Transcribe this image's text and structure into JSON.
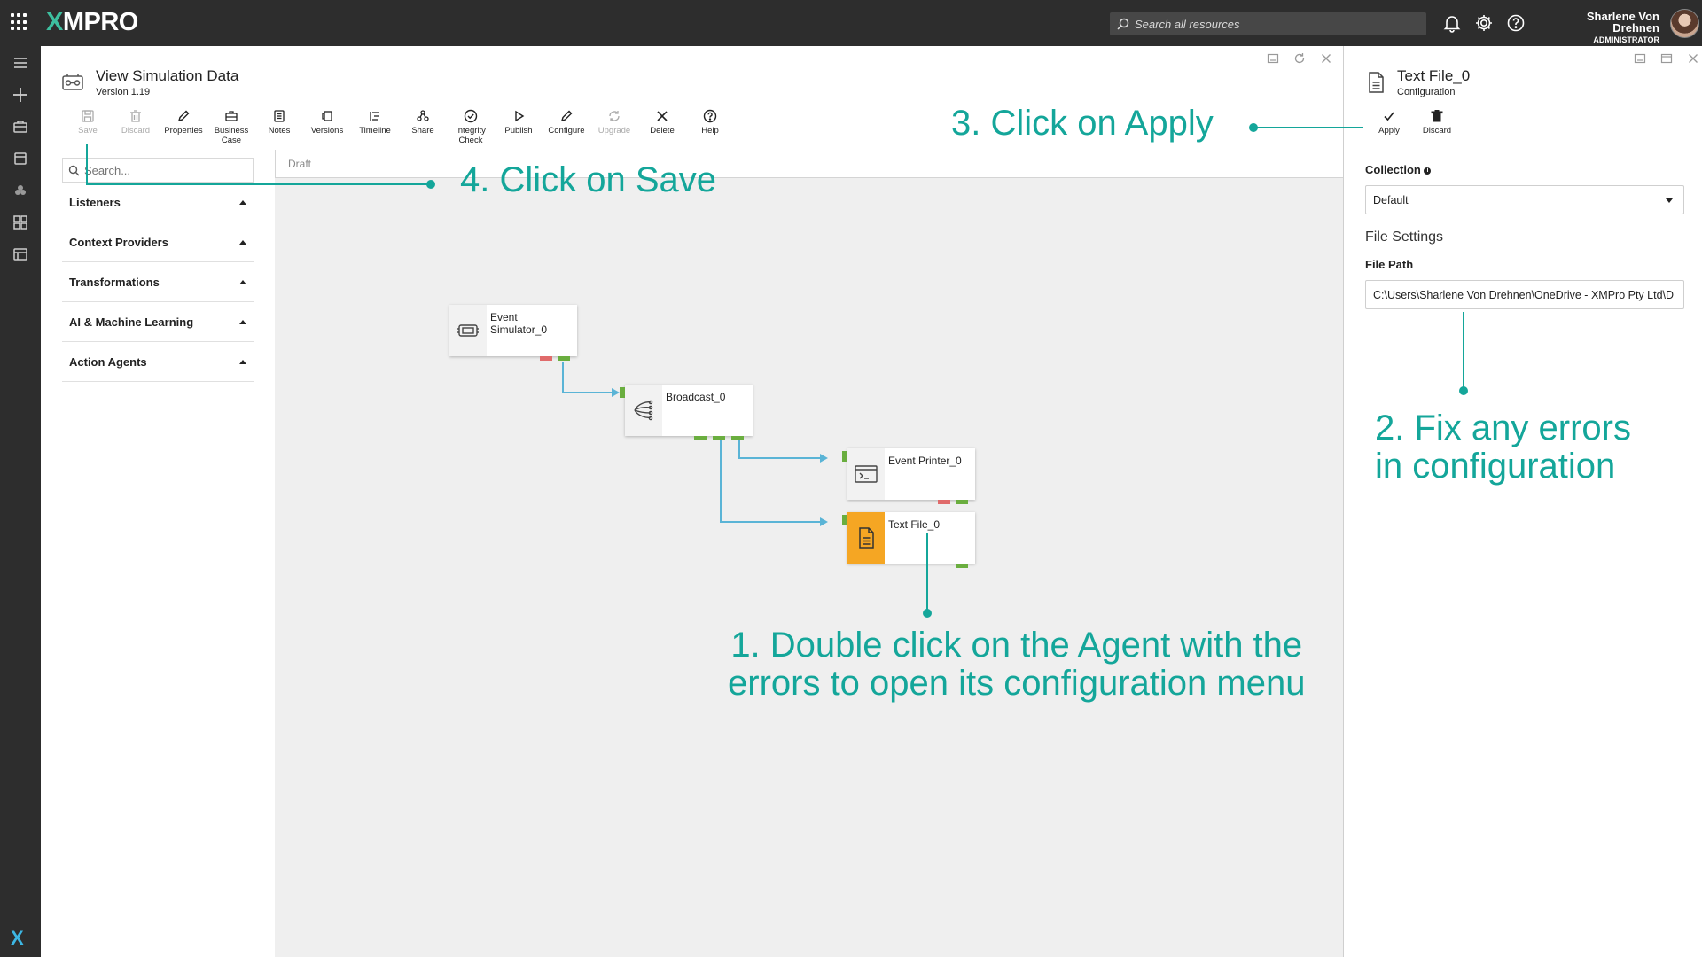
{
  "app": {
    "logo_x": "X",
    "logo_rest": "MPRO"
  },
  "topbar": {
    "search_placeholder": "Search all resources",
    "user_name": "Sharlene Von Drehnen",
    "user_role": "ADMINISTRATOR"
  },
  "page": {
    "title": "View Simulation Data",
    "version": "Version 1.19"
  },
  "toolbar": [
    {
      "label": "Save",
      "icon": "save-icon",
      "enabled": false
    },
    {
      "label": "Discard",
      "icon": "trash-icon",
      "enabled": false
    },
    {
      "label": "Properties",
      "icon": "pencil-icon",
      "enabled": true
    },
    {
      "label": "Business Case",
      "icon": "briefcase-icon",
      "enabled": true
    },
    {
      "label": "Notes",
      "icon": "notes-icon",
      "enabled": true
    },
    {
      "label": "Versions",
      "icon": "versions-icon",
      "enabled": true
    },
    {
      "label": "Timeline",
      "icon": "timeline-icon",
      "enabled": true
    },
    {
      "label": "Share",
      "icon": "share-icon",
      "enabled": true
    },
    {
      "label": "Integrity Check",
      "icon": "check-circle-icon",
      "enabled": true
    },
    {
      "label": "Publish",
      "icon": "play-icon",
      "enabled": true
    },
    {
      "label": "Configure",
      "icon": "pencil-icon",
      "enabled": true
    },
    {
      "label": "Upgrade",
      "icon": "refresh-icon",
      "enabled": false
    },
    {
      "label": "Delete",
      "icon": "close-icon",
      "enabled": true
    },
    {
      "label": "Help",
      "icon": "help-icon",
      "enabled": true
    }
  ],
  "palette": {
    "search_placeholder": "Search...",
    "categories": [
      "Listeners",
      "Context Providers",
      "Transformations",
      "AI & Machine Learning",
      "Action Agents"
    ]
  },
  "canvas": {
    "status": "Draft",
    "nodes": [
      {
        "label": "Event Simulator_0",
        "icon": "simulator-icon"
      },
      {
        "label": "Broadcast_0",
        "icon": "broadcast-icon"
      },
      {
        "label": "Event Printer_0",
        "icon": "terminal-icon"
      },
      {
        "label": "Text File_0",
        "icon": "text-file-icon",
        "highlight_color": "#f5a623"
      }
    ]
  },
  "panel": {
    "title": "Text File_0",
    "subtitle": "Configuration",
    "apply_label": "Apply",
    "discard_label": "Discard",
    "collection_label": "Collection",
    "collection_value": "Default",
    "file_settings_heading": "File Settings",
    "file_path_label": "File Path",
    "file_path_value": "C:\\Users\\Sharlene Von Drehnen\\OneDrive - XMPro Pty Ltd\\D"
  },
  "annotations": {
    "step1_line1": "1. Double click on the Agent with the",
    "step1_line2": "errors to open its configuration menu",
    "step2_line1": "2. Fix any errors",
    "step2_line2": "in configuration",
    "step3": "3. Click on Apply",
    "step4": "4. Click on Save"
  },
  "colors": {
    "topbar": "#2d2d2d",
    "accent": "#14a69a",
    "port_ok": "#6aae3f",
    "port_error": "#e06b6b",
    "connector": "#5ab4d6",
    "error_node": "#f5a623"
  }
}
